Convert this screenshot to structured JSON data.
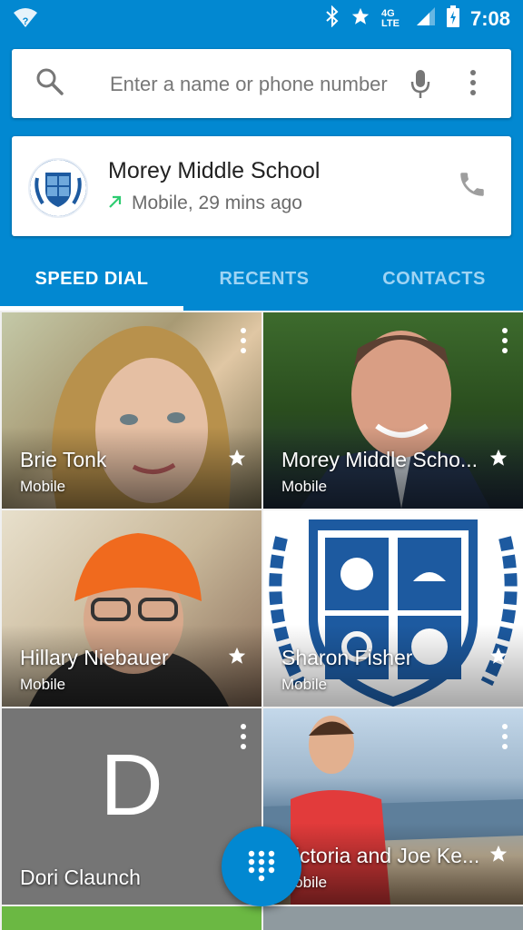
{
  "status_bar": {
    "network": "4G LTE",
    "time": "7:08"
  },
  "search": {
    "placeholder": "Enter a name or phone number",
    "value": ""
  },
  "recent_call": {
    "name": "Morey Middle School",
    "detail": "Mobile, 29 mins ago"
  },
  "tabs": [
    {
      "label": "SPEED DIAL",
      "active": true
    },
    {
      "label": "RECENTS",
      "active": false
    },
    {
      "label": "CONTACTS",
      "active": false
    }
  ],
  "speed_dial": [
    {
      "name": "Brie Tonk",
      "type": "Mobile",
      "starred": true
    },
    {
      "name": "Morey Middle Scho...",
      "type": "Mobile",
      "starred": true
    },
    {
      "name": "Hillary Niebauer",
      "type": "Mobile",
      "starred": true
    },
    {
      "name": "Sharon Fisher",
      "type": "Mobile",
      "starred": true
    },
    {
      "name": "Dori Claunch",
      "type": "",
      "initial": "D",
      "starred": false
    },
    {
      "name": "Victoria and Joe Ke...",
      "type": "Mobile",
      "starred": true
    }
  ],
  "colors": {
    "primary": "#0288d1",
    "tab_inactive": "#9fd4f4",
    "placeholder_tile": "#757575"
  }
}
